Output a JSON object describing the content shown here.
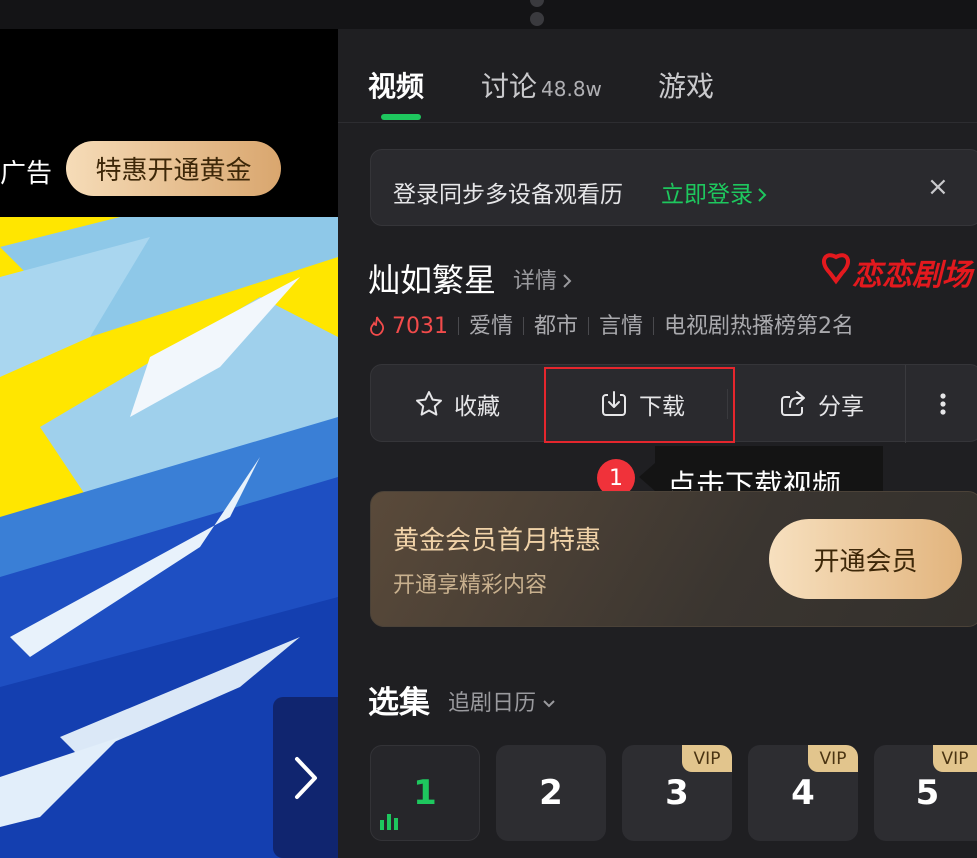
{
  "player": {
    "ad_label": "广告",
    "ad_button": "特惠开通黄金"
  },
  "tabs": [
    {
      "label": "视频"
    },
    {
      "label": "讨论",
      "count": "48.8w"
    },
    {
      "label": "游戏"
    }
  ],
  "login_bar": {
    "text": "登录同步多设备观看历",
    "link": "立即登录",
    "close": "×"
  },
  "show": {
    "title": "灿如繁星",
    "detail_link": "详情",
    "logo_text": "恋恋剧场",
    "heat": "7031",
    "tags": [
      "爱情",
      "都市",
      "言情",
      "电视剧热播榜第2名"
    ]
  },
  "actions": {
    "favorite": "收藏",
    "download": "下载",
    "share": "分享"
  },
  "guide": {
    "step": "1",
    "text": "点击下载视频"
  },
  "vip_card": {
    "title": "黄金会员首月特惠",
    "subtitle": "开通享精彩内容",
    "button": "开通会员"
  },
  "episodes": {
    "heading": "选集",
    "calendar": "追剧日历",
    "items": [
      {
        "number": "1",
        "vip": false,
        "current": true
      },
      {
        "number": "2",
        "vip": false,
        "current": false
      },
      {
        "number": "3",
        "vip": true,
        "current": false
      },
      {
        "number": "4",
        "vip": true,
        "current": false
      },
      {
        "number": "5",
        "vip": true,
        "current": false
      }
    ],
    "vip_tag": "VIP"
  },
  "colors": {
    "accent_green": "#1ec75e",
    "highlight_red": "#e5262d",
    "gold": "#e2c58d"
  }
}
